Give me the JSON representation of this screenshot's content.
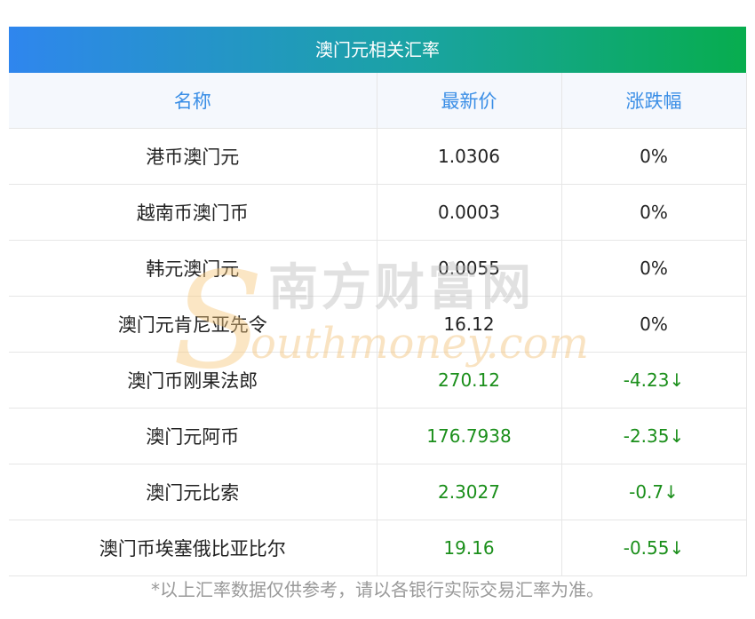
{
  "title": "澳门元相关汇率",
  "headers": [
    "名称",
    "最新价",
    "涨跌幅"
  ],
  "rows": [
    {
      "name": "港币澳门元",
      "price": "1.0306",
      "change": "0%",
      "trend": "flat"
    },
    {
      "name": "越南币澳门币",
      "price": "0.0003",
      "change": "0%",
      "trend": "flat"
    },
    {
      "name": "韩元澳门元",
      "price": "0.0055",
      "change": "0%",
      "trend": "flat"
    },
    {
      "name": "澳门元肯尼亚先令",
      "price": "16.12",
      "change": "0%",
      "trend": "flat"
    },
    {
      "name": "澳门币刚果法郎",
      "price": "270.12",
      "change": "-4.23↓",
      "trend": "down"
    },
    {
      "name": "澳门元阿币",
      "price": "176.7938",
      "change": "-2.35↓",
      "trend": "down"
    },
    {
      "name": "澳门元比索",
      "price": "2.3027",
      "change": "-0.7↓",
      "trend": "down"
    },
    {
      "name": "澳门币埃塞俄比亚比尔",
      "price": "19.16",
      "change": "-0.55↓",
      "trend": "down"
    }
  ],
  "watermark": {
    "cn": "南方财富网",
    "en": "outhmoney.com",
    "mark_letter": "S"
  },
  "footnote": "*以上汇率数据仅供参考，请以各银行实际交易汇率为准。",
  "colors": {
    "header_text": "#3a8ee6",
    "down": "#1b8f1b",
    "title_gradient": [
      "#2f86ee",
      "#07ad4e"
    ]
  }
}
